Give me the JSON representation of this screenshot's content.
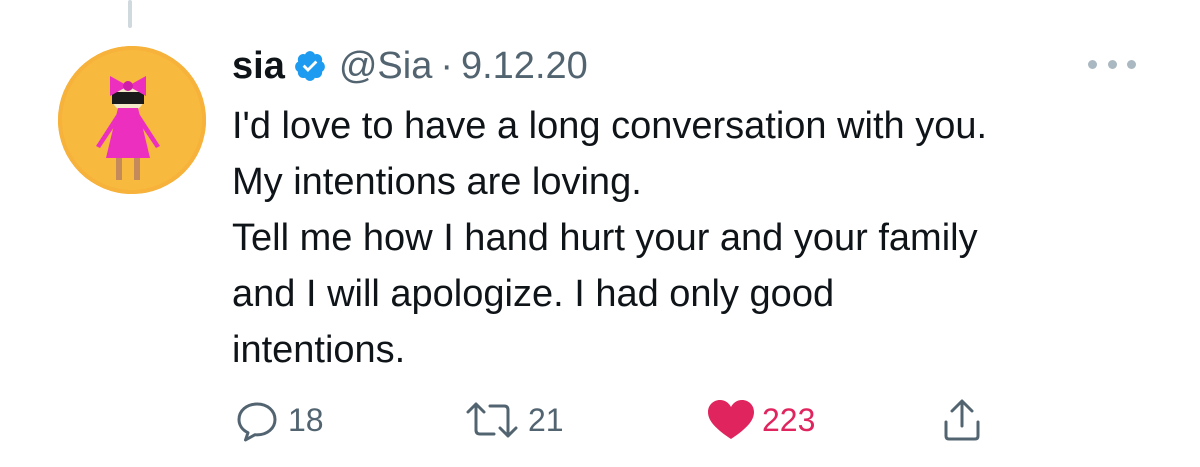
{
  "tweet": {
    "display_name": "sia",
    "handle": "@Sia",
    "separator": "·",
    "date": "9.12.20",
    "text_lines": [
      "I'd love to have a long conversation with you.",
      "My intentions are loving.",
      "Tell me how I hand hurt your and your family",
      "and I will apologize. I had only good",
      "intentions."
    ],
    "verified_icon": "verified-badge-icon",
    "avatar": "profile-photo"
  },
  "actions": {
    "reply": {
      "icon": "reply-icon",
      "count": "18"
    },
    "retweet": {
      "icon": "retweet-icon",
      "count": "21"
    },
    "like": {
      "icon": "heart-icon",
      "count": "223",
      "liked": true
    },
    "share": {
      "icon": "share-icon"
    }
  },
  "colors": {
    "text": "#0f1419",
    "secondary": "#536471",
    "verified": "#1d9bf0",
    "like": "#e0245e",
    "thread_line": "#cfd9de"
  }
}
